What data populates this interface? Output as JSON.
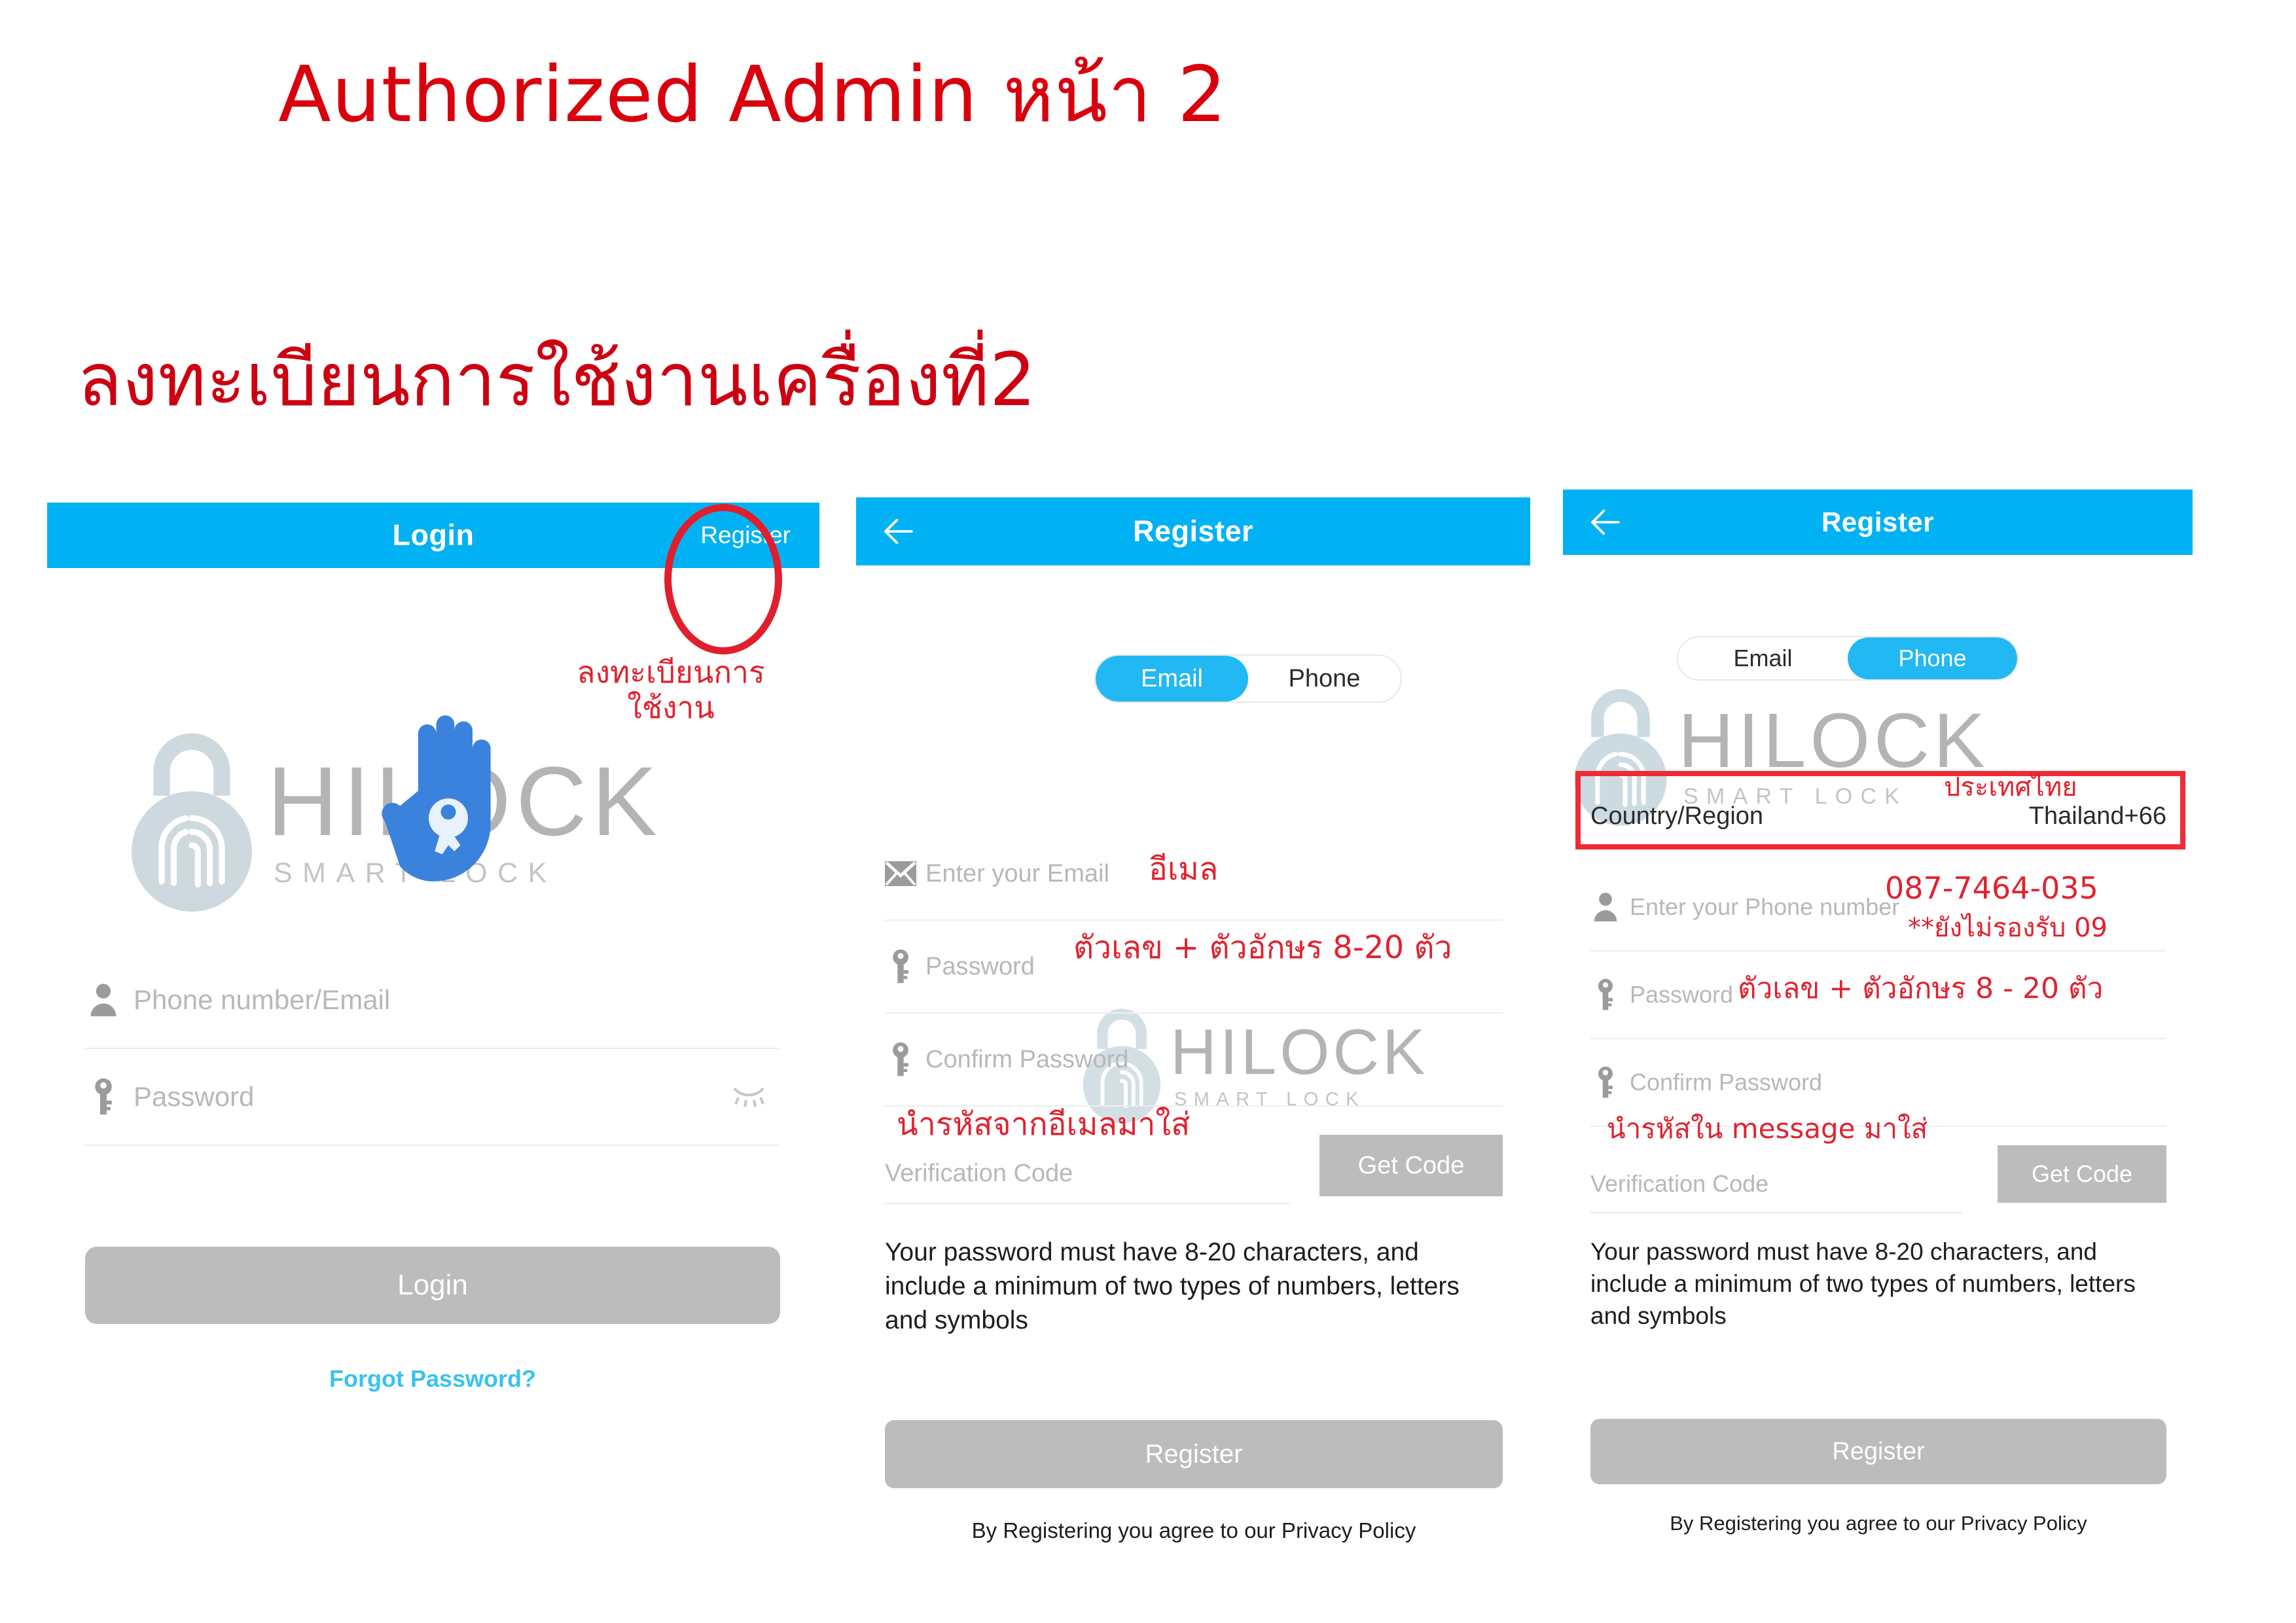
{
  "titles": {
    "main": "Authorized Admin หน้า 2",
    "sub": "ลงทะเบียนการใช้งานเครื่องที่2"
  },
  "logo": {
    "name": "HILOCK",
    "tagline": "SMART LOCK"
  },
  "panel_login": {
    "appbar": {
      "title": "Login",
      "action": "Register"
    },
    "annotation_register": "ลงทะเบียนการใช้งาน",
    "fields": [
      {
        "icon": "person-icon",
        "placeholder": "Phone number/Email"
      },
      {
        "icon": "key-icon",
        "placeholder": "Password"
      }
    ],
    "login_button": "Login",
    "forgot_link": "Forgot Password?"
  },
  "panel_email": {
    "appbar": {
      "title": "Register",
      "back": "back-arrow-icon"
    },
    "segment": {
      "options": [
        "Email",
        "Phone"
      ],
      "selected": "Email"
    },
    "fields": [
      {
        "icon": "envelope-icon",
        "placeholder": "Enter your Email",
        "annotation": "อีเมล"
      },
      {
        "icon": "key-icon",
        "placeholder": "Password",
        "annotation": "ตัวเลข + ตัวอักษร 8-20 ตัว"
      },
      {
        "icon": "key-icon",
        "placeholder": "Confirm Password",
        "annotation": ""
      }
    ],
    "verification": {
      "placeholder": "Verification Code",
      "get_code": "Get Code",
      "annotation": "นำรหัสจากอีเมลมาใส่"
    },
    "hint": "Your password must have 8-20 characters, and include a minimum of two types of numbers, letters and symbols",
    "register_button": "Register",
    "privacy": "By Registering you agree to our Privacy Policy"
  },
  "panel_phone": {
    "appbar": {
      "title": "Register",
      "back": "back-arrow-icon"
    },
    "segment": {
      "options": [
        "Email",
        "Phone"
      ],
      "selected": "Phone"
    },
    "country": {
      "label": "Country/Region",
      "value": "Thailand+66",
      "annotation": "ประเทศไทย"
    },
    "fields": [
      {
        "icon": "person-icon",
        "placeholder": "Enter your Phone number",
        "annotation": "087-7464-035",
        "annotation2": "**ยังไม่รองรับ 09"
      },
      {
        "icon": "key-icon",
        "placeholder": "Password",
        "annotation": "ตัวเลข + ตัวอักษร 8 - 20 ตัว"
      },
      {
        "icon": "key-icon",
        "placeholder": "Confirm Password",
        "annotation": ""
      }
    ],
    "verification": {
      "placeholder": "Verification Code",
      "get_code": "Get Code",
      "annotation": "นำรหัสใน message มาใส่"
    },
    "hint": "Your password must have 8-20 characters, and include a minimum of two types of numbers, letters and symbols",
    "register_button": "Register",
    "privacy": "By Registering you agree to our Privacy Policy"
  },
  "colors": {
    "appbar_blue": "#00b2f3",
    "accent_blue": "#21b8f4",
    "annotation_red": "#e0232f",
    "title_red": "#d9000d",
    "disabled_gray": "#bcbcbc",
    "link_blue": "#38c2ef"
  }
}
